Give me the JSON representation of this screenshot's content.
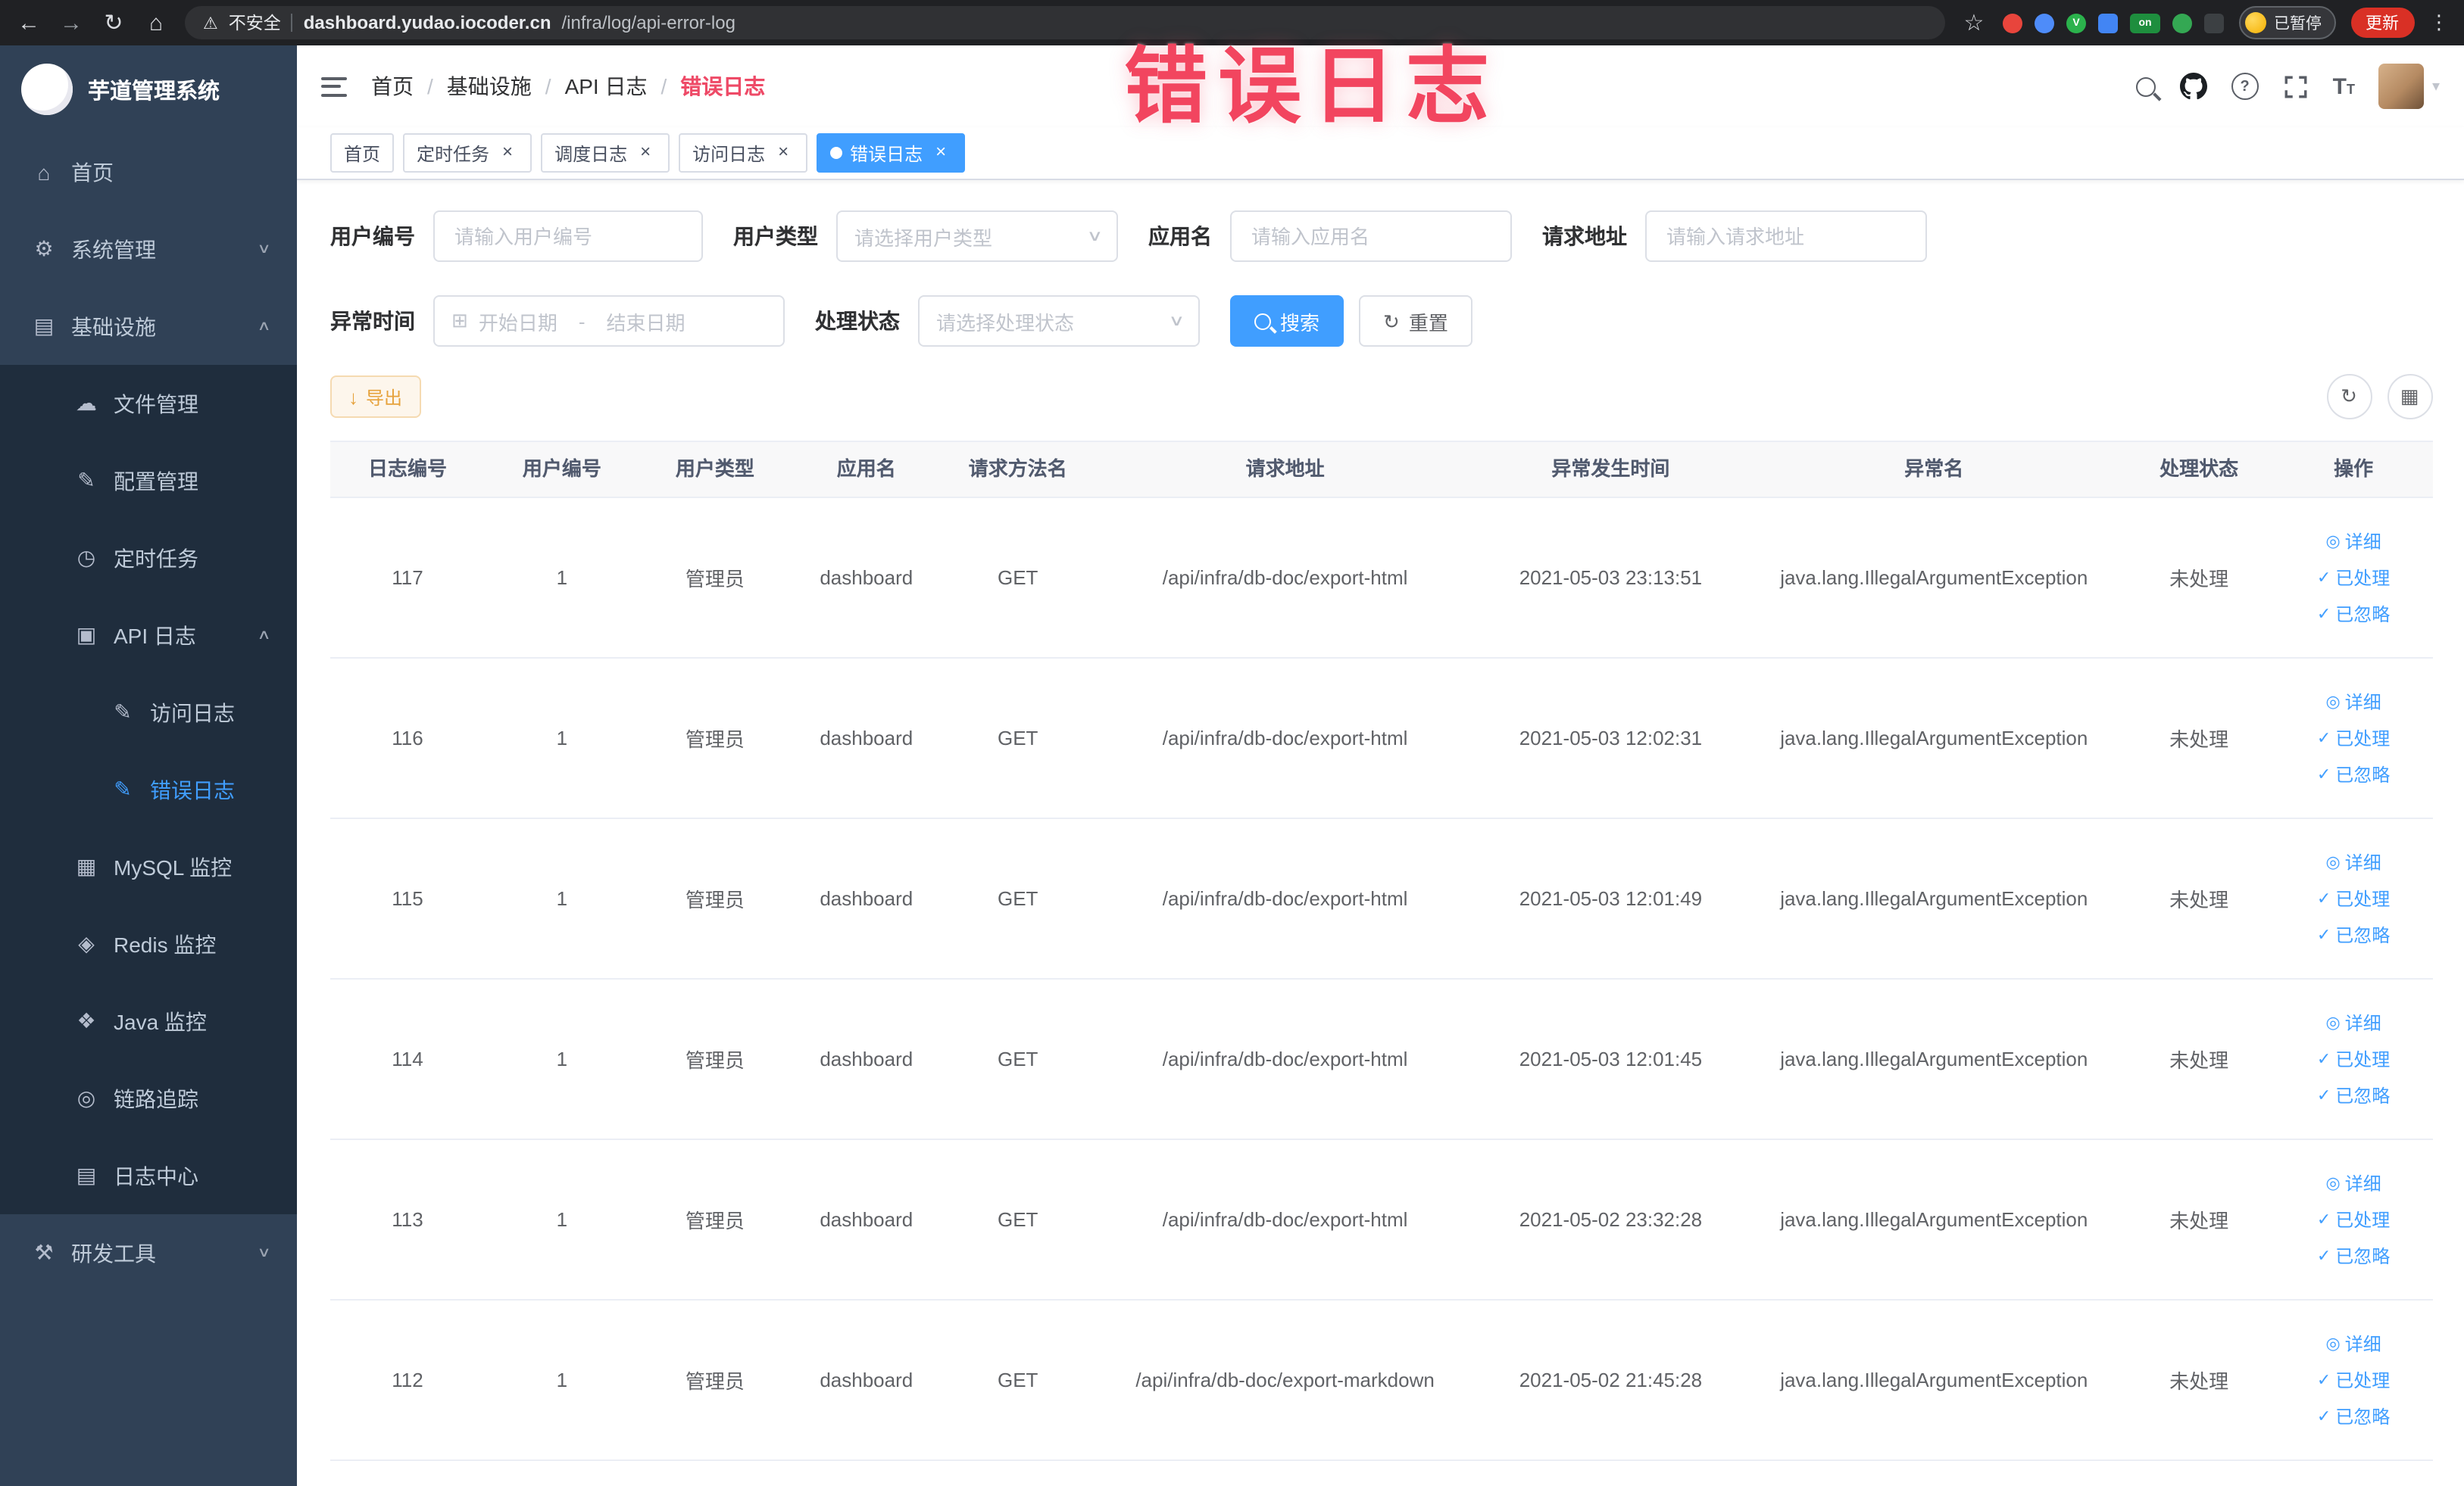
{
  "browser": {
    "back_icon": "←",
    "forward_icon": "→",
    "reload_icon": "↻",
    "home_icon": "⌂",
    "warning_icon": "⚠",
    "security_label": "不安全",
    "url_host": "dashboard.yudao.iocoder.cn",
    "url_path": "/infra/log/api-error-log",
    "star_icon": "☆",
    "extensions": [
      {
        "key": "ext-red",
        "color": "#e8453c",
        "text": "",
        "shape": "round"
      },
      {
        "key": "ext-blue-drop",
        "color": "#4e8cf9",
        "text": "",
        "shape": "round"
      },
      {
        "key": "ext-green-v",
        "color": "#2bb24c",
        "text": "V",
        "shape": "round"
      },
      {
        "key": "ext-blue-grid",
        "color": "#4285f4",
        "text": "",
        "shape": "sq"
      },
      {
        "key": "ext-on-badge",
        "color": "#1e8e3e",
        "text": "on",
        "shape": "wide"
      },
      {
        "key": "ext-green-leaf",
        "color": "#34a853",
        "text": "",
        "shape": "round"
      },
      {
        "key": "ext-puzzle",
        "color": "#3c4043",
        "text": "",
        "shape": "sq"
      }
    ],
    "profile_label": "已暂停",
    "update_label": "更新",
    "menu_icon": "⋮"
  },
  "annotation": {
    "text": "错误日志"
  },
  "sidebar": {
    "logo_title": "芋道管理系统",
    "items": [
      {
        "key": "home",
        "label": "首页",
        "icon": "home-icon",
        "glyph": "⌂",
        "level": 1
      },
      {
        "key": "system-mgmt",
        "label": "系统管理",
        "icon": "gear-icon",
        "glyph": "⚙",
        "level": 1,
        "chevron": "down"
      },
      {
        "key": "infrastructure",
        "label": "基础设施",
        "icon": "infra-icon",
        "glyph": "▤",
        "level": 1,
        "chevron": "up"
      },
      {
        "key": "file-mgmt",
        "label": "文件管理",
        "icon": "cloud-icon",
        "glyph": "☁",
        "level": 2
      },
      {
        "key": "config-mgmt",
        "label": "配置管理",
        "icon": "edit-icon",
        "glyph": "✎",
        "level": 2
      },
      {
        "key": "scheduled-job",
        "label": "定时任务",
        "icon": "clock-icon",
        "glyph": "◷",
        "level": 2
      },
      {
        "key": "api-log",
        "label": "API 日志",
        "icon": "document-icon",
        "glyph": "▣",
        "level": 2,
        "chevron": "up"
      },
      {
        "key": "access-log",
        "label": "访问日志",
        "icon": "edit-square-icon",
        "glyph": "✎",
        "level": 3
      },
      {
        "key": "error-log",
        "label": "错误日志",
        "icon": "edit-square-icon",
        "glyph": "✎",
        "level": 3,
        "active": true
      },
      {
        "key": "mysql-monitor",
        "label": "MySQL 监控",
        "icon": "database-icon",
        "glyph": "▦",
        "level": 2
      },
      {
        "key": "redis-monitor",
        "label": "Redis 监控",
        "icon": "redis-icon",
        "glyph": "◈",
        "level": 2
      },
      {
        "key": "java-monitor",
        "label": "Java 监控",
        "icon": "java-icon",
        "glyph": "❖",
        "level": 2
      },
      {
        "key": "link-trace",
        "label": "链路追踪",
        "icon": "eye-icon",
        "glyph": "◎",
        "level": 2
      },
      {
        "key": "log-center",
        "label": "日志中心",
        "icon": "log-icon",
        "glyph": "▤",
        "level": 2
      },
      {
        "key": "dev-tools",
        "label": "研发工具",
        "icon": "tools-icon",
        "glyph": "⚒",
        "level": 1,
        "chevron": "down"
      }
    ]
  },
  "header": {
    "breadcrumb": [
      "首页",
      "基础设施",
      "API 日志",
      "错误日志"
    ],
    "breadcrumb_separator": "/",
    "icons": {
      "help": "?",
      "font_large": "T",
      "font_small": "T",
      "avatar_caret": "▾"
    }
  },
  "tabs_close_icon": "×",
  "tabs": [
    {
      "label": "首页",
      "closable": false,
      "active": false
    },
    {
      "label": "定时任务",
      "closable": true,
      "active": false
    },
    {
      "label": "调度日志",
      "closable": true,
      "active": false
    },
    {
      "label": "访问日志",
      "closable": true,
      "active": false
    },
    {
      "label": "错误日志",
      "closable": true,
      "active": true
    }
  ],
  "filters": {
    "caret_icon": "∨",
    "calendar_icon": "⊞",
    "reset_icon": "↻",
    "fields": [
      {
        "type": "input",
        "label": "用户编号",
        "placeholder": "请输入用户编号"
      },
      {
        "type": "select",
        "label": "用户类型",
        "placeholder": "请选择用户类型"
      },
      {
        "type": "input",
        "label": "应用名",
        "placeholder": "请输入应用名"
      },
      {
        "type": "input",
        "label": "请求地址",
        "placeholder": "请输入请求地址"
      },
      {
        "type": "daterange",
        "label": "异常时间",
        "start_placeholder": "开始日期",
        "separator": "-",
        "end_placeholder": "结束日期"
      },
      {
        "type": "select",
        "label": "处理状态",
        "placeholder": "请选择处理状态"
      }
    ],
    "search_label": "搜索",
    "reset_label": "重置"
  },
  "toolbar": {
    "export_label": "导出",
    "export_icon": "↓",
    "refresh_icon": "↻",
    "columns_icon": "▦"
  },
  "table": {
    "columns": [
      "日志编号",
      "用户编号",
      "用户类型",
      "应用名",
      "请求方法名",
      "请求地址",
      "异常发生时间",
      "异常名",
      "处理状态",
      "操作"
    ],
    "rows": [
      [
        "117",
        "1",
        "管理员",
        "dashboard",
        "GET",
        "/api/infra/db-doc/export-html",
        "2021-05-03 23:13:51",
        "java.lang.IllegalArgumentException",
        "未处理"
      ],
      [
        "116",
        "1",
        "管理员",
        "dashboard",
        "GET",
        "/api/infra/db-doc/export-html",
        "2021-05-03 12:02:31",
        "java.lang.IllegalArgumentException",
        "未处理"
      ],
      [
        "115",
        "1",
        "管理员",
        "dashboard",
        "GET",
        "/api/infra/db-doc/export-html",
        "2021-05-03 12:01:49",
        "java.lang.IllegalArgumentException",
        "未处理"
      ],
      [
        "114",
        "1",
        "管理员",
        "dashboard",
        "GET",
        "/api/infra/db-doc/export-html",
        "2021-05-03 12:01:45",
        "java.lang.IllegalArgumentException",
        "未处理"
      ],
      [
        "113",
        "1",
        "管理员",
        "dashboard",
        "GET",
        "/api/infra/db-doc/export-html",
        "2021-05-02 23:32:28",
        "java.lang.IllegalArgumentException",
        "未处理"
      ],
      [
        "112",
        "1",
        "管理员",
        "dashboard",
        "GET",
        "/api/infra/db-doc/export-markdown",
        "2021-05-02 21:45:28",
        "java.lang.IllegalArgumentException",
        "未处理"
      ]
    ],
    "actions": [
      {
        "name": "detail",
        "icon": "◎",
        "icon_name": "view-icon",
        "label": "详细"
      },
      {
        "name": "processed",
        "icon": "✓",
        "icon_name": "check-icon",
        "label": "已处理"
      },
      {
        "name": "ignored",
        "icon": "✓",
        "icon_name": "check-icon",
        "label": "已忽略"
      }
    ]
  }
}
